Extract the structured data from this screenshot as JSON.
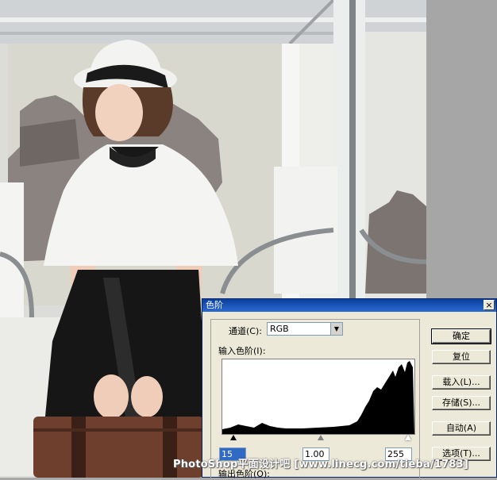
{
  "dialog": {
    "title": "色阶",
    "close_glyph": "×",
    "channel_label": "通道(C):",
    "channel_value": "RGB",
    "input_levels_label": "输入色阶(I):",
    "output_levels_label": "输出色阶(O):",
    "input_black": "15",
    "input_gamma": "1.00",
    "input_white": "255",
    "buttons": {
      "ok": "确定",
      "reset": "复位",
      "load": "载入(L)...",
      "save": "存储(S)...",
      "auto": "自动(A)",
      "options": "选项(T)..."
    }
  },
  "watermark": "PhotoShop平面设计吧 [www.linecg.com/tieba/1783]",
  "colors": {
    "title_bar": "#0a3f9c",
    "dialog_bg": "#ece9d8"
  }
}
